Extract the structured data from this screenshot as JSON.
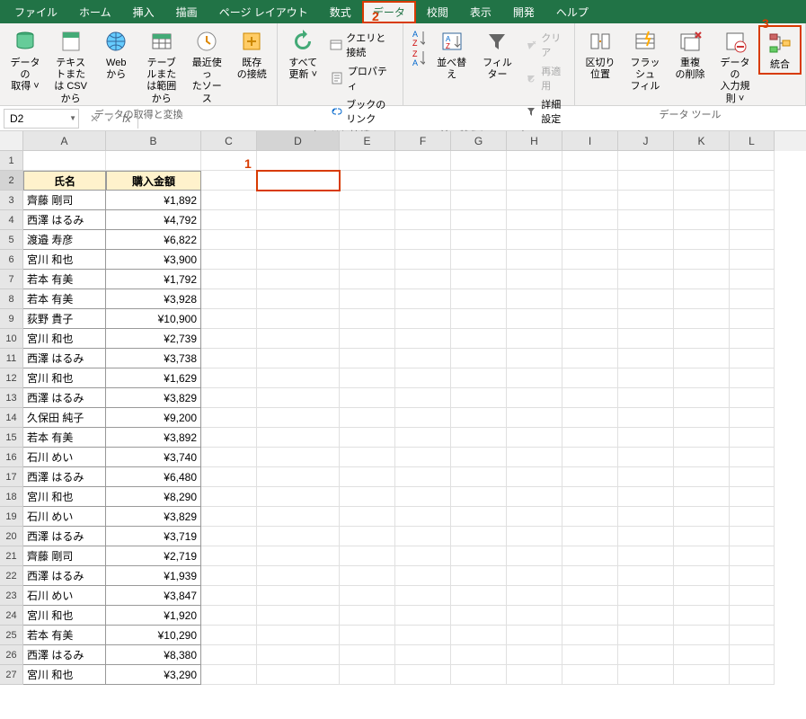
{
  "menu": {
    "tabs": [
      "ファイル",
      "ホーム",
      "挿入",
      "描画",
      "ページ レイアウト",
      "数式",
      "データ",
      "校閲",
      "表示",
      "開発",
      "ヘルプ"
    ],
    "active_index": 6
  },
  "annotations": {
    "a1": "1",
    "a2": "2",
    "a3": "3"
  },
  "ribbon": {
    "groups": [
      {
        "label": "データの取得と変換",
        "buttons": [
          {
            "label": "データの\n取得 ˅",
            "icon": "db-icon"
          },
          {
            "label": "テキストまた\nは CSV から",
            "icon": "csv-icon"
          },
          {
            "label": "Web\nから",
            "icon": "web-icon"
          },
          {
            "label": "テーブルまた\nは範囲から",
            "icon": "table-icon"
          },
          {
            "label": "最近使っ\nたソース",
            "icon": "recent-icon"
          },
          {
            "label": "既存\nの接続",
            "icon": "conn-icon"
          }
        ]
      },
      {
        "label": "クエリと接続",
        "buttons": [
          {
            "label": "すべて\n更新 ˅",
            "icon": "refresh-icon"
          }
        ],
        "small": [
          {
            "label": "クエリと接続",
            "icon": "query-icon"
          },
          {
            "label": "プロパティ",
            "icon": "prop-icon"
          },
          {
            "label": "ブックのリンク",
            "icon": "link-icon"
          }
        ]
      },
      {
        "label": "並べ替えとフィルター",
        "buttons": [
          {
            "label": "",
            "icon": "sort-az-icon",
            "mini": true
          },
          {
            "label": "",
            "icon": "sort-za-icon",
            "mini": true
          },
          {
            "label": "並べ替え",
            "icon": "sort-icon"
          },
          {
            "label": "フィルター",
            "icon": "filter-icon"
          }
        ],
        "small": [
          {
            "label": "クリア",
            "icon": "clear-icon",
            "disabled": true
          },
          {
            "label": "再適用",
            "icon": "reapply-icon",
            "disabled": true
          },
          {
            "label": "詳細設定",
            "icon": "advanced-icon"
          }
        ]
      },
      {
        "label": "データ ツール",
        "buttons": [
          {
            "label": "区切り位置",
            "icon": "split-icon"
          },
          {
            "label": "フラッシュ\nフィル",
            "icon": "flash-icon"
          },
          {
            "label": "重複\nの削除",
            "icon": "dup-icon"
          },
          {
            "label": "データの\n入力規則 ˅",
            "icon": "valid-icon"
          },
          {
            "label": "統合",
            "icon": "consol-icon",
            "highlight": true
          }
        ]
      }
    ]
  },
  "namebox": "D2",
  "fx": "fx",
  "columns": [
    "A",
    "B",
    "C",
    "D",
    "E",
    "F",
    "G",
    "H",
    "I",
    "J",
    "K",
    "L"
  ],
  "headers": {
    "A": "氏名",
    "B": "購入金額"
  },
  "rows": [
    {
      "n": 1
    },
    {
      "n": 2,
      "A": "",
      "B": "",
      "header": true,
      "selected": true
    },
    {
      "n": 3,
      "A": "齊藤 剛司",
      "B": "¥1,892"
    },
    {
      "n": 4,
      "A": "西澤 はるみ",
      "B": "¥4,792"
    },
    {
      "n": 5,
      "A": "渡邉 寿彦",
      "B": "¥6,822"
    },
    {
      "n": 6,
      "A": "宮川 和也",
      "B": "¥3,900"
    },
    {
      "n": 7,
      "A": "若本 有美",
      "B": "¥1,792"
    },
    {
      "n": 8,
      "A": "若本 有美",
      "B": "¥3,928"
    },
    {
      "n": 9,
      "A": "荻野 貴子",
      "B": "¥10,900"
    },
    {
      "n": 10,
      "A": "宮川 和也",
      "B": "¥2,739"
    },
    {
      "n": 11,
      "A": "西澤 はるみ",
      "B": "¥3,738"
    },
    {
      "n": 12,
      "A": "宮川 和也",
      "B": "¥1,629"
    },
    {
      "n": 13,
      "A": "西澤 はるみ",
      "B": "¥3,829"
    },
    {
      "n": 14,
      "A": "久保田 純子",
      "B": "¥9,200"
    },
    {
      "n": 15,
      "A": "若本 有美",
      "B": "¥3,892"
    },
    {
      "n": 16,
      "A": "石川 めい",
      "B": "¥3,740"
    },
    {
      "n": 17,
      "A": "西澤 はるみ",
      "B": "¥6,480"
    },
    {
      "n": 18,
      "A": "宮川 和也",
      "B": "¥8,290"
    },
    {
      "n": 19,
      "A": "石川 めい",
      "B": "¥3,829"
    },
    {
      "n": 20,
      "A": "西澤 はるみ",
      "B": "¥3,719"
    },
    {
      "n": 21,
      "A": "齊藤 剛司",
      "B": "¥2,719"
    },
    {
      "n": 22,
      "A": "西澤 はるみ",
      "B": "¥1,939"
    },
    {
      "n": 23,
      "A": "石川 めい",
      "B": "¥3,847"
    },
    {
      "n": 24,
      "A": "宮川 和也",
      "B": "¥1,920"
    },
    {
      "n": 25,
      "A": "若本 有美",
      "B": "¥10,290"
    },
    {
      "n": 26,
      "A": "西澤 はるみ",
      "B": "¥8,380"
    },
    {
      "n": 27,
      "A": "宮川 和也",
      "B": "¥3,290"
    }
  ]
}
